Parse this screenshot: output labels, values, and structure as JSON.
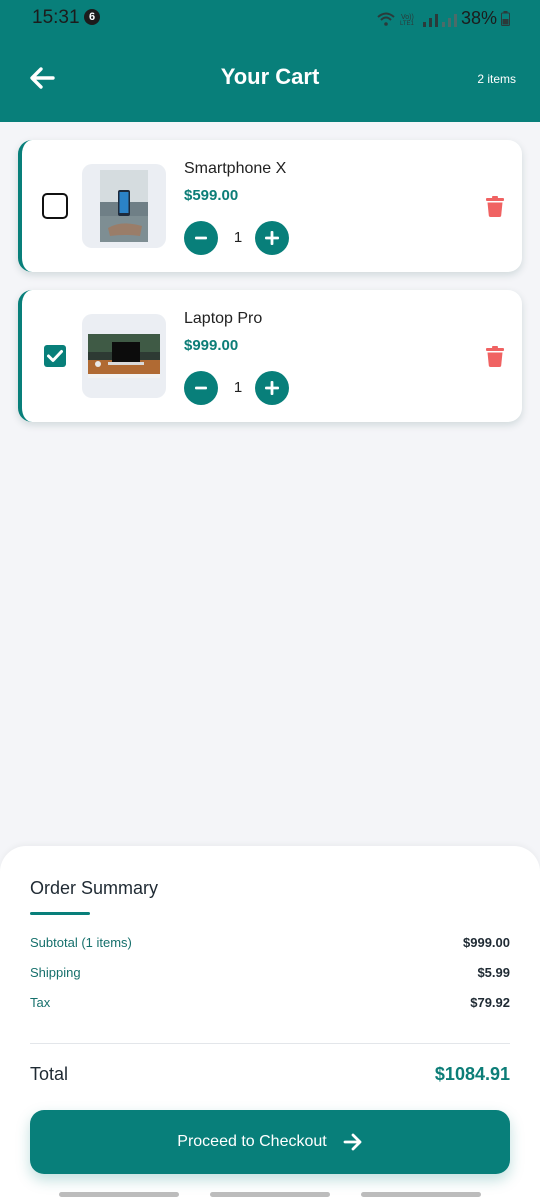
{
  "status_bar": {
    "time": "15:31",
    "notification_count": "6",
    "network_label": "Vo))\nLTE1",
    "battery": "38%"
  },
  "header": {
    "title": "Your Cart",
    "item_count": "2 items"
  },
  "cart_items": [
    {
      "name": "Smartphone X",
      "price": "$599.00",
      "quantity": "1",
      "selected": false
    },
    {
      "name": "Laptop Pro",
      "price": "$999.00",
      "quantity": "1",
      "selected": true
    }
  ],
  "summary": {
    "title": "Order Summary",
    "subtotal_label": "Subtotal (1 items)",
    "subtotal_value": "$999.00",
    "shipping_label": "Shipping",
    "shipping_value": "$5.99",
    "tax_label": "Tax",
    "tax_value": "$79.92",
    "total_label": "Total",
    "total_value": "$1084.91"
  },
  "checkout_button": {
    "label": "Proceed to Checkout"
  },
  "colors": {
    "primary": "#087f7a",
    "price": "#0c7d77",
    "delete": "#f06262",
    "background": "#f4f5f8"
  }
}
